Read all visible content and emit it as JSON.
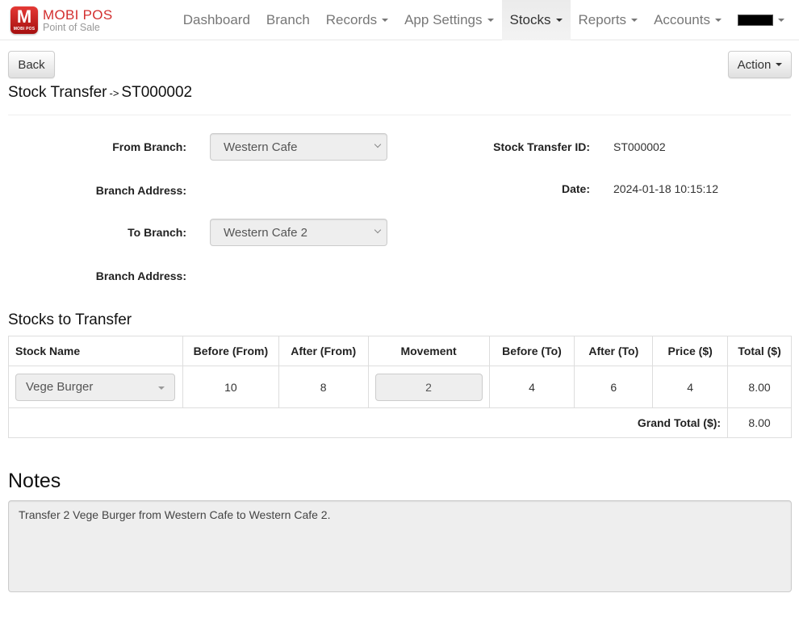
{
  "brand": {
    "logo_letter": "M",
    "logo_caption": "MOBI POS",
    "name": "MOBI POS",
    "subtitle": "Point of Sale"
  },
  "nav": {
    "items": [
      {
        "label": "Dashboard",
        "dropdown": false,
        "active": false
      },
      {
        "label": "Branch",
        "dropdown": false,
        "active": false
      },
      {
        "label": "Records",
        "dropdown": true,
        "active": false
      },
      {
        "label": "App Settings",
        "dropdown": true,
        "active": false
      },
      {
        "label": "Stocks",
        "dropdown": true,
        "active": true
      },
      {
        "label": "Reports",
        "dropdown": true,
        "active": false
      },
      {
        "label": "Accounts",
        "dropdown": true,
        "active": false
      }
    ],
    "user_menu_redacted": true
  },
  "toolbar": {
    "back_label": "Back",
    "action_label": "Action"
  },
  "page": {
    "title": "Stock Transfer",
    "arrow": "->",
    "transfer_code": "ST000002"
  },
  "form": {
    "from_branch_label": "From Branch:",
    "from_branch_value": "Western Cafe",
    "from_address_label": "Branch Address:",
    "from_address_value": "",
    "to_branch_label": "To Branch:",
    "to_branch_value": "Western Cafe 2",
    "to_address_label": "Branch Address:",
    "to_address_value": "",
    "transfer_id_label": "Stock Transfer ID:",
    "transfer_id_value": "ST000002",
    "date_label": "Date:",
    "date_value": "2024-01-18 10:15:12"
  },
  "stocks": {
    "section_title": "Stocks to Transfer",
    "columns": [
      "Stock Name",
      "Before (From)",
      "After (From)",
      "Movement",
      "Before (To)",
      "After (To)",
      "Price ($)",
      "Total ($)"
    ],
    "rows": [
      {
        "stock_name": "Vege Burger",
        "before_from": "10",
        "after_from": "8",
        "movement": "2",
        "before_to": "4",
        "after_to": "6",
        "price": "4",
        "total": "8.00"
      }
    ],
    "grand_total_label": "Grand Total ($):",
    "grand_total_value": "8.00"
  },
  "notes": {
    "title": "Notes",
    "text": "Transfer 2 Vege Burger from Western Cafe to Western Cafe 2."
  }
}
